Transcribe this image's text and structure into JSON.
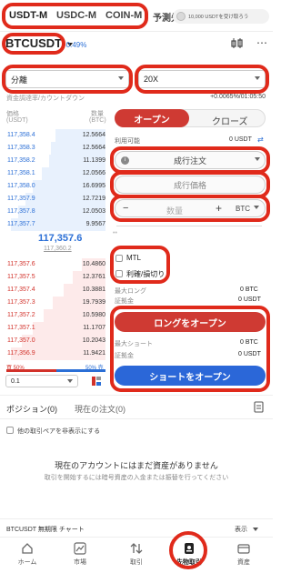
{
  "tabs": [
    {
      "label": "USDT-M"
    },
    {
      "label": "USDC-M"
    },
    {
      "label": "COIN-M"
    },
    {
      "label": "予測先"
    }
  ],
  "promo": {
    "text": "10,000 USDTを受け取ろう"
  },
  "header": {
    "symbol": "BTCUSDT",
    "change_pct": "-0.49%"
  },
  "margin": {
    "mode": "分離",
    "leverage": "20X"
  },
  "funding": {
    "label": "資金調達率/カウントダウン",
    "value": "+0.0065%/01:05:50"
  },
  "orderbook": {
    "price_header": "価格",
    "price_unit": "(USDT)",
    "qty_header": "数量",
    "qty_unit": "(BTC)",
    "bids": [
      {
        "price": "117,358.4",
        "qty": "12.5664"
      },
      {
        "price": "117,358.3",
        "qty": "12.5664"
      },
      {
        "price": "117,358.2",
        "qty": "11.1399"
      },
      {
        "price": "117,358.1",
        "qty": "12.0566"
      },
      {
        "price": "117,358.0",
        "qty": "16.6995"
      },
      {
        "price": "117,357.9",
        "qty": "12.7219"
      },
      {
        "price": "117,357.8",
        "qty": "12.0503"
      },
      {
        "price": "117,357.7",
        "qty": "9.9567"
      }
    ],
    "last_price": "117,357.6",
    "mark_price": "117,360.2",
    "asks": [
      {
        "price": "117,357.6",
        "qty": "10.4860"
      },
      {
        "price": "117,357.5",
        "qty": "12.3761"
      },
      {
        "price": "117,357.4",
        "qty": "10.3881"
      },
      {
        "price": "117,357.3",
        "qty": "19.7939"
      },
      {
        "price": "117,357.2",
        "qty": "10.5980"
      },
      {
        "price": "117,357.1",
        "qty": "11.1707"
      },
      {
        "price": "117,357.0",
        "qty": "10.2043"
      },
      {
        "price": "117,356.9",
        "qty": "11.9421"
      }
    ],
    "buy_ratio": "買 50%",
    "sell_ratio": "50% 売",
    "precision": "0.1"
  },
  "order_panel": {
    "open_tab": "オープン",
    "close_tab": "クローズ",
    "available_label": "利用可能",
    "available_value": "0 USDT",
    "order_type": "成行注文",
    "price_field": "成行価格",
    "qty_placeholder": "数量",
    "qty_minus": "−",
    "qty_plus": "+",
    "qty_unit": "BTC",
    "mtl_label": "MTL",
    "tpsl_label": "利確/損切り",
    "max_long_label": "最大ロング",
    "max_long_value": "0 BTC",
    "margin_label": "証拠金",
    "margin_value": "0 USDT",
    "long_button": "ロングをオープン",
    "max_short_label": "最大ショート",
    "max_short_value": "0 BTC",
    "margin2_label": "証拠金",
    "margin2_value": "0 USDT",
    "short_button": "ショートをオープン"
  },
  "positions": {
    "tab_positions": "ポジション(0)",
    "tab_orders": "現在の注文(0)",
    "hide_other_label": "他の取引ペアを非表示にする",
    "empty_title": "現在のアカウントにはまだ資産がありません",
    "empty_hint": "取引を開始するには暗号資産の入金または振替を行ってください"
  },
  "chart_bar": {
    "label": "BTCUSDT 無期限 チャート",
    "toggle": "表示"
  },
  "nav": [
    {
      "label": "ホーム"
    },
    {
      "label": "市場"
    },
    {
      "label": "取引"
    },
    {
      "label": "先物取引"
    },
    {
      "label": "資産"
    }
  ],
  "colors": {
    "accent_red": "#d2312a",
    "long_red": "#cf3a33",
    "short_blue": "#2b67d8",
    "bid_blue": "#2b6fd6",
    "highlight_ring": "#e02a1b"
  }
}
